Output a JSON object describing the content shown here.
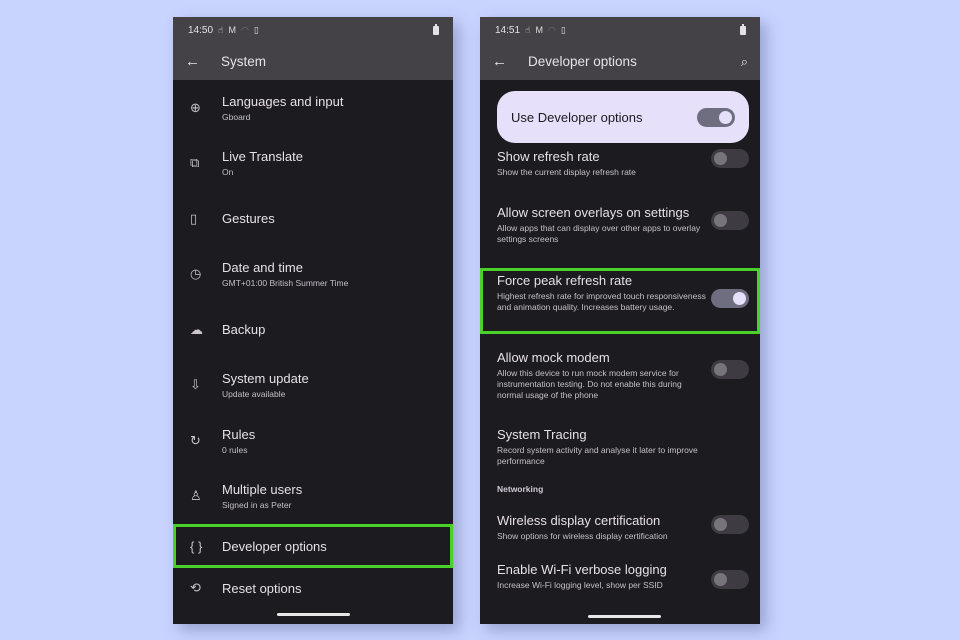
{
  "left_phone": {
    "status": {
      "time": "14:50"
    },
    "appbar": {
      "title": "System"
    },
    "items": [
      {
        "icon": "globe-icon",
        "glyph": "⊕",
        "title": "Languages and input",
        "sub": "Gboard"
      },
      {
        "icon": "translate-icon",
        "glyph": "⧉",
        "title": "Live Translate",
        "sub": "On"
      },
      {
        "icon": "gestures-icon",
        "glyph": "▯",
        "title": "Gestures",
        "sub": ""
      },
      {
        "icon": "clock-icon",
        "glyph": "◷",
        "title": "Date and time",
        "sub": "GMT+01:00 British Summer Time"
      },
      {
        "icon": "cloud-upload-icon",
        "glyph": "☁",
        "title": "Backup",
        "sub": ""
      },
      {
        "icon": "system-update-icon",
        "glyph": "⇩",
        "title": "System update",
        "sub": "Update available"
      },
      {
        "icon": "rules-icon",
        "glyph": "↻",
        "title": "Rules",
        "sub": "0 rules"
      },
      {
        "icon": "person-icon",
        "glyph": "♙",
        "title": "Multiple users",
        "sub": "Signed in as Peter"
      },
      {
        "icon": "braces-icon",
        "glyph": "{ }",
        "title": "Developer options",
        "sub": ""
      },
      {
        "icon": "history-icon",
        "glyph": "⟲",
        "title": "Reset options",
        "sub": ""
      }
    ]
  },
  "right_phone": {
    "status": {
      "time": "14:51"
    },
    "appbar": {
      "title": "Developer options"
    },
    "master": {
      "label": "Use Developer options",
      "on": true
    },
    "rows": [
      {
        "title": "Show refresh rate",
        "sub": "Show the current display refresh rate",
        "on": false
      },
      {
        "title": "Allow screen overlays on settings",
        "sub": "Allow apps that can display over other apps to overlay settings screens",
        "on": false
      },
      {
        "title": "Force peak refresh rate",
        "sub": "Highest refresh rate for improved touch responsiveness and animation quality. Increases battery usage.",
        "on": true
      },
      {
        "title": "Allow mock modem",
        "sub": "Allow this device to run mock modem service for instrumentation testing. Do not enable this during normal usage of the phone",
        "on": false
      },
      {
        "title": "System Tracing",
        "sub": "Record system activity and analyse it later to improve performance"
      }
    ],
    "section": "Networking",
    "net_rows": [
      {
        "title": "Wireless display certification",
        "sub": "Show options for wireless display certification",
        "on": false
      },
      {
        "title": "Enable Wi-Fi verbose logging",
        "sub": "Increase Wi-Fi logging level, show per SSID",
        "on": false
      }
    ]
  },
  "colors": {
    "highlight": "#4ad22b",
    "background": "#c8d4fe"
  }
}
